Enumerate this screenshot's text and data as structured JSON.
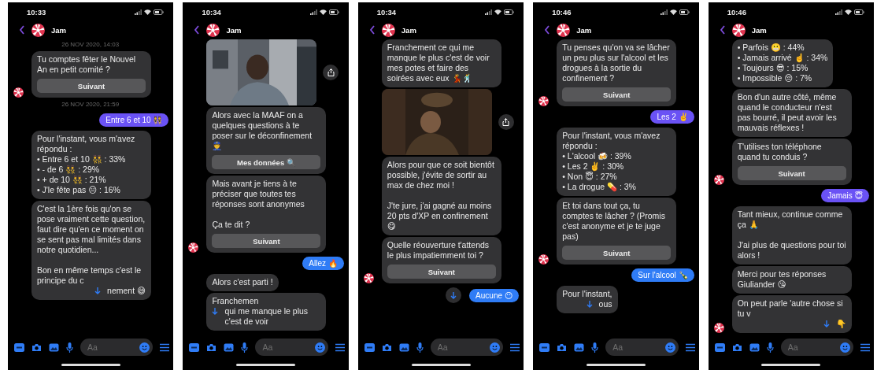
{
  "phones": [
    {
      "time": "10:33",
      "contact": "Jam",
      "placeholder": "Aa",
      "messages": [
        {
          "kind": "date",
          "text": "26 NOV 2020, 14:03"
        },
        {
          "kind": "bot",
          "text": "Tu comptes fêter le Nouvel An en petit comité ?",
          "button": "Suivant",
          "avatar": true
        },
        {
          "kind": "date",
          "text": "26 NOV 2020, 21:59"
        },
        {
          "kind": "user",
          "text": "Entre 6 et 10 👯",
          "color": "#6a52f5"
        },
        {
          "kind": "bot",
          "text": "Pour l'instant, vous m'avez répondu :\n• Entre 6 et 10 👯 : 33%\n• - de 6 👯 : 29%\n• + de 10 👯 : 21%\n• J'le fête pas 😑 : 16%"
        },
        {
          "kind": "bot",
          "text": "C'est la 1ère fois qu'on se pose vraiment cette question, faut dire qu'en ce moment on se sent pas mal limités dans notre quotidien...\n\nBon en même temps c'est le principe du c",
          "text_after": "nement 😅"
        }
      ]
    },
    {
      "time": "10:34",
      "contact": "Jam",
      "placeholder": "Aa",
      "messages": [
        {
          "kind": "picture"
        },
        {
          "kind": "bot",
          "text": "Alors avec la MAAF on a quelques questions à te poser sur le déconfinement 👮",
          "button": "Mes données 🔍"
        },
        {
          "kind": "bot",
          "text": "Mais avant je tiens à te préciser que toutes tes réponses sont anonymes\n\nÇa te dit ?",
          "button": "Suivant",
          "avatar": true
        },
        {
          "kind": "user",
          "text": "Allez 🔥",
          "color": "#2f7cf6"
        },
        {
          "kind": "bot",
          "text": "Alors c'est parti !"
        },
        {
          "kind": "bot",
          "text": "Franchemen",
          "text_after": "qui me manque le plus c'est de voir"
        }
      ]
    },
    {
      "time": "10:34",
      "contact": "Jam",
      "placeholder": "Aa",
      "messages": [
        {
          "kind": "bot",
          "text": "Franchement ce qui me manque le plus c'est de voir mes potes et faire des soirées avec eux 💃🕺"
        },
        {
          "kind": "picture"
        },
        {
          "kind": "bot",
          "text": "Alors pour que ce soit bientôt possible, j'évite de sortir au max de chez moi !\n\nJ'te jure, j'ai gagné au moins 20 pts d'XP en confinement 😋"
        },
        {
          "kind": "bot",
          "text": "Quelle réouverture t'attends le plus impatiemment toi ?",
          "button": "Suivant",
          "avatar": true
        },
        {
          "kind": "user",
          "text": "Aucune 😶",
          "color": "#2f7cf6",
          "scroll_button": true
        }
      ]
    },
    {
      "time": "10:46",
      "contact": "Jam",
      "placeholder": "Aa",
      "messages": [
        {
          "kind": "bot",
          "text": "Tu penses qu'on va se lâcher un peu plus sur l'alcool et les drogues à la sortie du confinement ?",
          "button": "Suivant",
          "avatar": true
        },
        {
          "kind": "user",
          "text": "Les 2 ✌️",
          "color": "#6a52f5"
        },
        {
          "kind": "bot",
          "text": "Pour l'instant, vous m'avez répondu :\n• L'alcool 🍻 : 39%\n• Les 2 ✌️ : 30%\n• Non 😇 : 27%\n• La drogue 💊 : 3%"
        },
        {
          "kind": "bot",
          "text": "Et toi dans tout ça, tu comptes te lâcher ? (Promis c'est anonyme et je te juge pas)",
          "button": "Suivant",
          "avatar": true
        },
        {
          "kind": "user",
          "text": "Sur l'alcool 🍾",
          "color": "#2f7cf6"
        },
        {
          "kind": "bot",
          "text": "Pour l'instant,",
          "text_after": "ous"
        }
      ]
    },
    {
      "time": "10:46",
      "contact": "Jam",
      "placeholder": "Aa",
      "messages": [
        {
          "kind": "bot",
          "text": "• Parfois 😬 : 44%\n• Jamais arrivé ☝️ : 34%\n• Toujours 😎 : 15%\n• Impossible 😔 : 7%"
        },
        {
          "kind": "bot",
          "text": "Bon d'un autre côté, même quand le conducteur n'est pas bourré, il peut avoir les mauvais réflexes !"
        },
        {
          "kind": "bot",
          "text": "T'utilises ton téléphone quand tu conduis ?",
          "button": "Suivant",
          "avatar": true
        },
        {
          "kind": "user",
          "text": "Jamais 😇",
          "color": "#6a52f5"
        },
        {
          "kind": "bot",
          "text": "Tant mieux, continue comme ça 🙏\n\nJ'ai plus de questions pour toi alors !"
        },
        {
          "kind": "bot",
          "text": "Merci pour tes réponses Giuliander 😘"
        },
        {
          "kind": "bot",
          "text": "On peut parle  'autre chose si tu v",
          "text_after": "👇",
          "avatar": true
        }
      ]
    }
  ]
}
